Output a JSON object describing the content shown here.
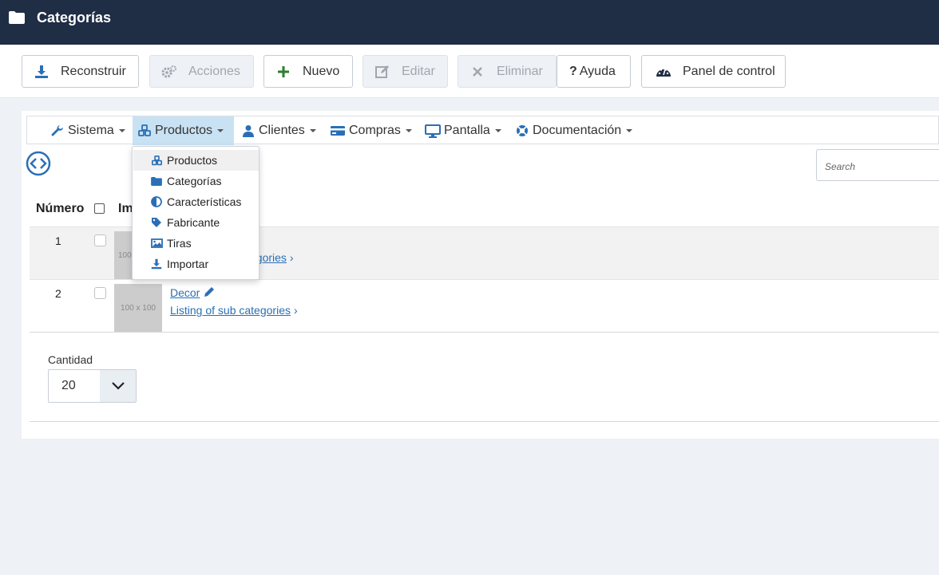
{
  "header": {
    "title": "Categorías"
  },
  "toolbar": {
    "rebuild": "Reconstruir",
    "actions": "Acciones",
    "new": "Nuevo",
    "edit": "Editar",
    "delete": "Eliminar",
    "help": "Ayuda",
    "control_panel": "Panel de control"
  },
  "menu": {
    "items": [
      {
        "label": "Sistema",
        "icon": "wrench-icon"
      },
      {
        "label": "Productos",
        "icon": "cubes-icon"
      },
      {
        "label": "Clientes",
        "icon": "user-icon"
      },
      {
        "label": "Compras",
        "icon": "credit-card-icon"
      },
      {
        "label": "Pantalla",
        "icon": "desktop-icon"
      },
      {
        "label": "Documentación",
        "icon": "lifebuoy-icon"
      }
    ]
  },
  "dropdown": {
    "items": [
      {
        "label": "Productos",
        "icon": "cubes-icon"
      },
      {
        "label": "Categorías",
        "icon": "folder-icon"
      },
      {
        "label": "Características",
        "icon": "adjust-icon"
      },
      {
        "label": "Fabricante",
        "icon": "tag-icon"
      },
      {
        "label": "Tiras",
        "icon": "image-icon"
      },
      {
        "label": "Importar",
        "icon": "download-icon"
      }
    ]
  },
  "search": {
    "placeholder": "Search"
  },
  "table": {
    "headers": {
      "number": "Número",
      "image": "Im"
    },
    "rows": [
      {
        "number": "1",
        "name": "",
        "sublink": "egories",
        "thumb": "100"
      },
      {
        "number": "2",
        "name": "Decor",
        "sublink": "Listing of sub categories",
        "thumb": "100 x 100"
      }
    ]
  },
  "pagination": {
    "label": "Cantidad",
    "value": "20"
  },
  "colors": {
    "header_bg": "#1f2d45",
    "accent": "#2a6fb6",
    "menu_active": "#c9e2f3"
  }
}
